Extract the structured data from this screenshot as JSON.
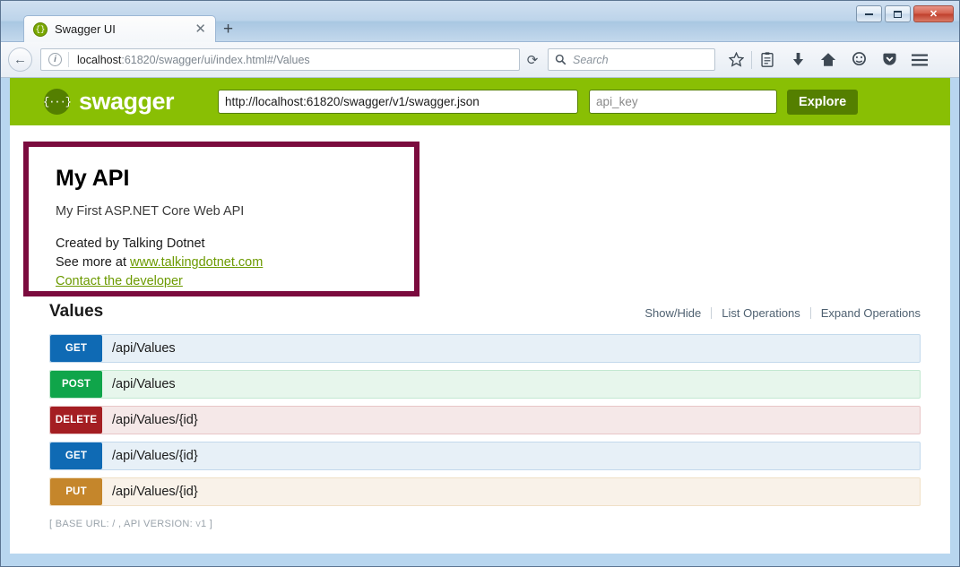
{
  "window": {
    "minimize_label": "Minimize",
    "maximize_label": "Maximize",
    "close_label": "✕"
  },
  "browser": {
    "tab": {
      "title": "Swagger UI",
      "close_label": "✕",
      "favicon": "swagger-favicon"
    },
    "new_tab_label": "+",
    "back_label": "←",
    "url_prefix": "localhost",
    "url_rest": ":61820/swagger/ui/index.html#/Values",
    "url_full": "localhost:61820/swagger/ui/index.html#/Values",
    "reload_label": "⟳",
    "search_placeholder": "Search",
    "icons": [
      "star-icon",
      "reading-list-icon",
      "download-icon",
      "home-icon",
      "feedback-icon",
      "pocket-icon",
      "menu-icon"
    ]
  },
  "swagger_header": {
    "logo_glyph": "{···}",
    "brand": "swagger",
    "api_url_value": "http://localhost:61820/swagger/v1/swagger.json",
    "api_key_placeholder": "api_key",
    "api_key_value": "",
    "explore_label": "Explore",
    "bar_color": "#89bf04",
    "accent_color": "#547f00"
  },
  "api_info": {
    "title": "My API",
    "description": "My First ASP.NET Core Web API",
    "created_by": "Created by Talking Dotnet",
    "see_more_prefix": "See more at ",
    "see_more_link": "www.talkingdotnet.com",
    "contact_link": "Contact the developer",
    "highlight_color": "#7b0b3e"
  },
  "resource": {
    "title": "Values",
    "show_hide": "Show/Hide",
    "list_operations": "List Operations",
    "expand_operations": "Expand Operations",
    "operations": [
      {
        "method": "GET",
        "path": "/api/Values",
        "color": "#0f6ab4"
      },
      {
        "method": "POST",
        "path": "/api/Values",
        "color": "#10a54a"
      },
      {
        "method": "DELETE",
        "path": "/api/Values/{id}",
        "color": "#a41e22"
      },
      {
        "method": "GET",
        "path": "/api/Values/{id}",
        "color": "#0f6ab4"
      },
      {
        "method": "PUT",
        "path": "/api/Values/{id}",
        "color": "#c5862b"
      }
    ]
  },
  "footer": {
    "base_url_info": "[ BASE URL: / , API VERSION: v1 ]"
  }
}
